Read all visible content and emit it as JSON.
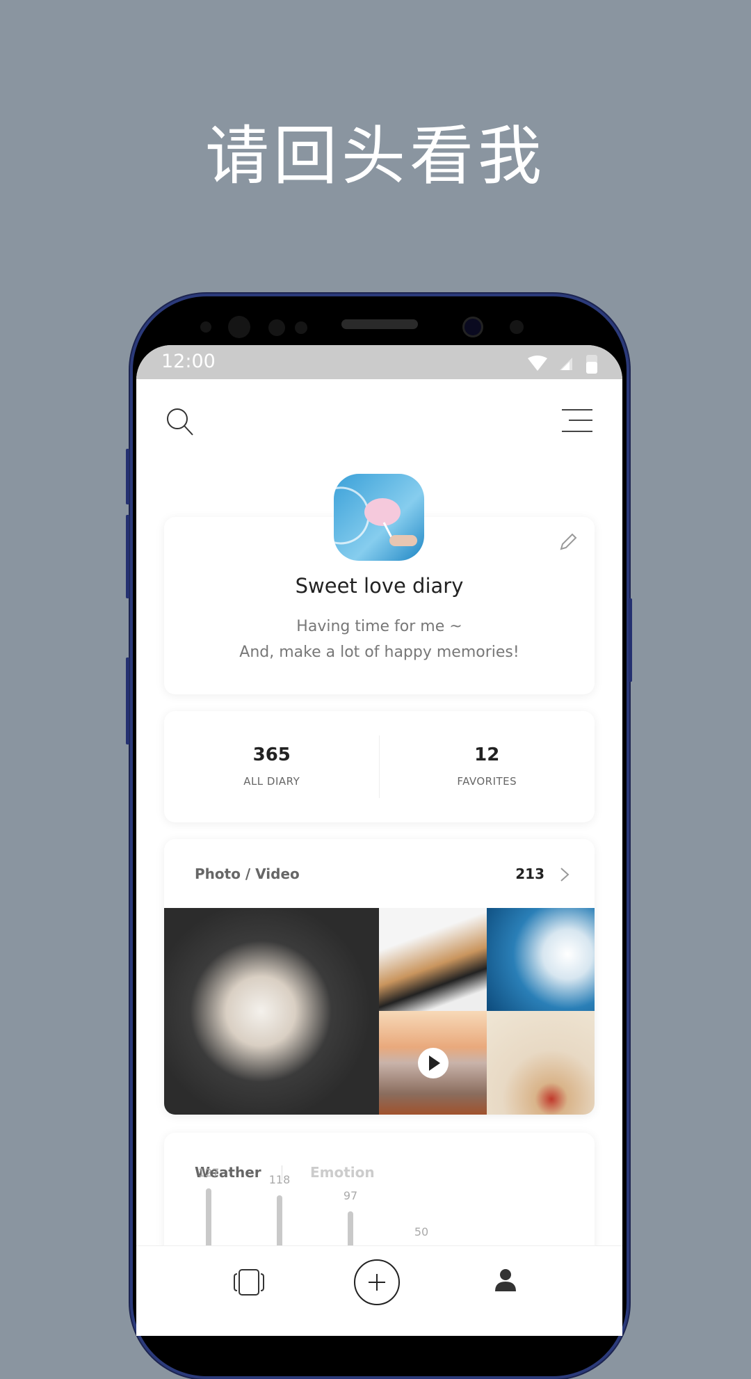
{
  "headline": "请回头看我",
  "status_bar": {
    "time": "12:00",
    "icons": [
      "wifi-icon",
      "signal-icon",
      "battery-icon"
    ]
  },
  "header": {
    "search_icon": "search-icon",
    "menu_icon": "menu-icon"
  },
  "profile": {
    "title": "Sweet love diary",
    "description_line1": "Having time for me ~",
    "description_line2": "And, make a lot of happy memories!",
    "edit_icon": "pencil-icon"
  },
  "stats": [
    {
      "value": "365",
      "label": "ALL DIARY"
    },
    {
      "value": "12",
      "label": "FAVORITES"
    }
  ],
  "media": {
    "title": "Photo / Video",
    "count": "213",
    "photos": [
      "cat",
      "clothes-hangers",
      "sky-clouds",
      "sunset-sea-video",
      "gift-box"
    ]
  },
  "weather_card": {
    "tabs": [
      {
        "label": "Weather",
        "active": true
      },
      {
        "label": "Emotion",
        "active": false
      }
    ],
    "chart_data": {
      "type": "bar",
      "values": [
        127,
        118,
        97,
        50
      ]
    }
  },
  "bottom_nav": {
    "items": [
      "cards-icon",
      "add-icon",
      "profile-icon"
    ]
  },
  "colors": {
    "background": "#8a95a0",
    "status_bar": "#cbcbcb",
    "text_dark": "#222222"
  }
}
